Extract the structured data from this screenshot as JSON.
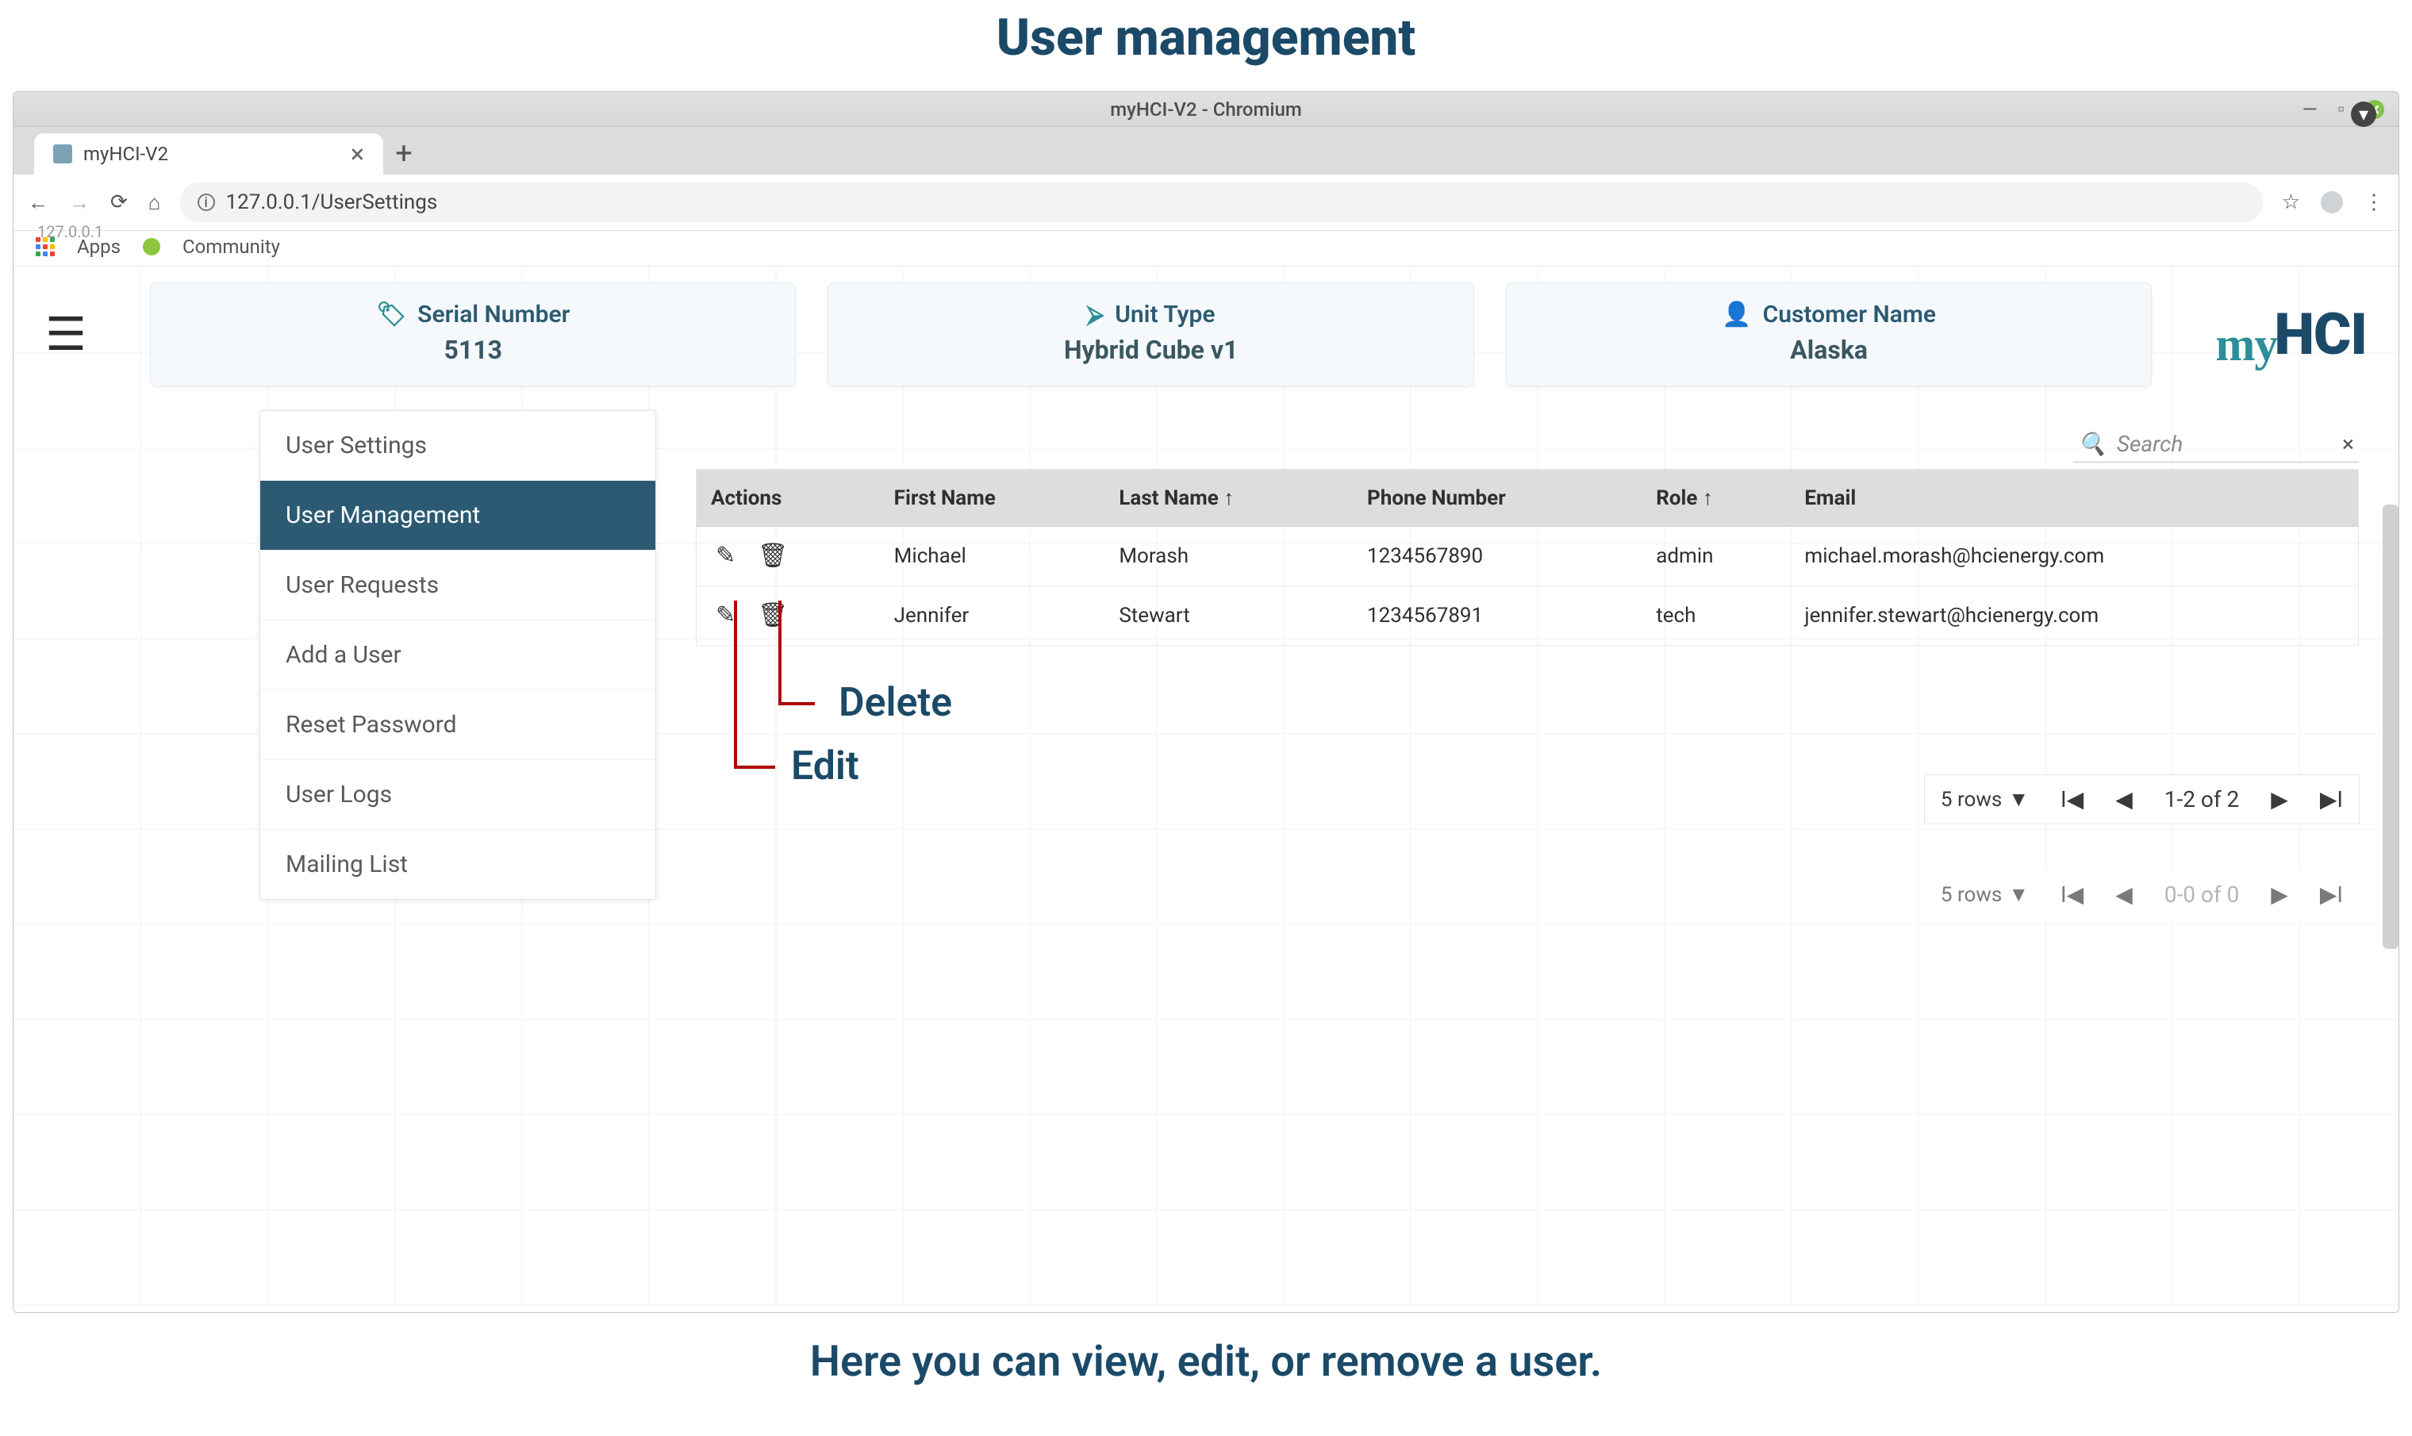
{
  "page_heading": "User management",
  "footer_desc": "Here you can view, edit, or remove a user.",
  "browser": {
    "window_title": "myHCI-V2 - Chromium",
    "tab_title": "myHCI-V2",
    "url": "127.0.0.1/UserSettings",
    "overlay_text": "127.0.0.1",
    "bookmarks": {
      "apps": "Apps",
      "community": "Community"
    }
  },
  "topbar": {
    "cards": [
      {
        "label": "Serial Number",
        "value": "5113",
        "icon": "tag-icon"
      },
      {
        "label": "Unit Type",
        "value": "Hybrid Cube v1",
        "icon": "double-arrow-icon"
      },
      {
        "label": "Customer Name",
        "value": "Alaska",
        "icon": "person-icon"
      }
    ],
    "brand_prefix": "my",
    "brand_main": "HCI"
  },
  "sidebar": {
    "items": [
      "User Settings",
      "User Management",
      "User Requests",
      "Add a User",
      "Reset Password",
      "User Logs",
      "Mailing List"
    ],
    "active_index": 1
  },
  "search": {
    "placeholder": "Search"
  },
  "table": {
    "columns": [
      "Actions",
      "First Name",
      "Last Name ↑",
      "Phone Number",
      "Role ↑",
      "Email"
    ],
    "rows": [
      {
        "first": "Michael",
        "last": "Morash",
        "phone": "1234567890",
        "role": "admin",
        "email": "michael.morash@hcienergy.com"
      },
      {
        "first": "Jennifer",
        "last": "Stewart",
        "phone": "1234567891",
        "role": "tech",
        "email": "jennifer.stewart@hcienergy.com"
      }
    ]
  },
  "annotations": {
    "delete": "Delete",
    "edit": "Edit"
  },
  "pager_inner": {
    "rows_label": "5 rows",
    "range": "1-2 of 2"
  },
  "pager_outer": {
    "rows_label": "5 rows",
    "range": "0-0 of 0"
  }
}
